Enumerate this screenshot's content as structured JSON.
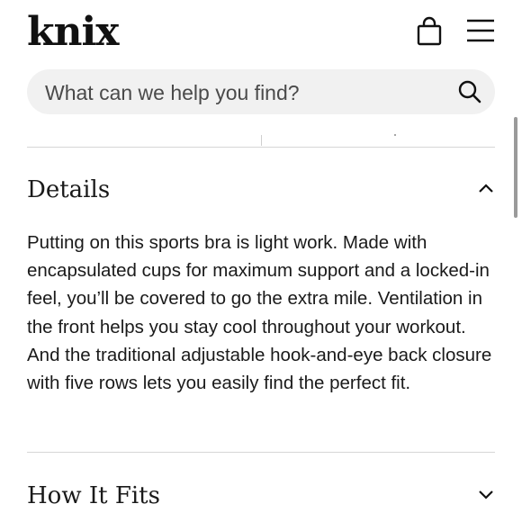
{
  "header": {
    "logo": "knix",
    "icons": [
      "shopping-bag-icon",
      "hamburger-menu-icon"
    ]
  },
  "search": {
    "placeholder": "What can we help you find?",
    "value": "",
    "icon": "search-icon"
  },
  "accordions": [
    {
      "title": "Details",
      "expanded": true,
      "icon": "chevron-up-icon",
      "body": "Putting on this sports bra is light work. Made with encapsulated cups for maximum support and a locked-in feel, you’ll be covered to go the extra mile. Ventilation in the front helps you stay cool throughout your workout. And the traditional adjustable hook-and-eye back closure with five rows lets you easily find the perfect fit."
    },
    {
      "title": "How It Fits",
      "expanded": false,
      "icon": "chevron-down-icon"
    }
  ],
  "colors": {
    "text": "#1a1a1a",
    "search_background": "#f1f1f1",
    "divider": "#d6d6d6"
  }
}
